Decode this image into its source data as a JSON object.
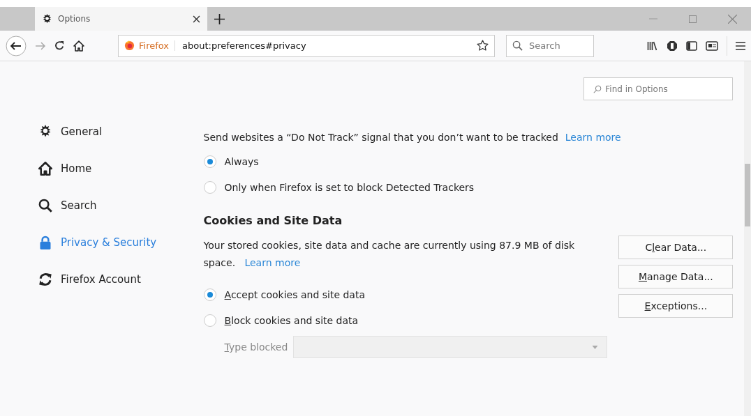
{
  "tab": {
    "title": "Options",
    "selected": true
  },
  "urlbar": {
    "identity": "Firefox",
    "url": "about:preferences#privacy"
  },
  "search": {
    "placeholder": "Search"
  },
  "find": {
    "placeholder": "Find in Options"
  },
  "sidebar": {
    "items": [
      {
        "label": "General",
        "kind": "gear",
        "selected": false
      },
      {
        "label": "Home",
        "kind": "home",
        "selected": false
      },
      {
        "label": "Search",
        "kind": "search",
        "selected": false
      },
      {
        "label": "Privacy & Security",
        "kind": "lock",
        "selected": true
      },
      {
        "label": "Firefox Account",
        "kind": "sync",
        "selected": false
      }
    ]
  },
  "dnt": {
    "text": "Send websites a “Do Not Track” signal that you don’t want to be tracked",
    "link": "Learn more",
    "options": [
      {
        "label": {
          "after": "Always"
        },
        "selected": true
      },
      {
        "label": {
          "after": "Only when Firefox is set to block Detected Trackers"
        },
        "selected": false
      }
    ]
  },
  "cookies": {
    "heading": "Cookies and Site Data",
    "text": "Your stored cookies, site data and cache are currently using 87.9 MB of disk space.",
    "link": "Learn more",
    "buttons": [
      {
        "label": {
          "before": "C",
          "key": "l",
          "after": "ear Data..."
        }
      },
      {
        "label": {
          "key": "M",
          "after": "anage Data..."
        }
      },
      {
        "label": {
          "key": "E",
          "after": "xceptions..."
        }
      }
    ],
    "options": [
      {
        "label": {
          "key": "A",
          "after": "ccept cookies and site data"
        },
        "selected": true
      },
      {
        "label": {
          "key": "B",
          "after": "lock cookies and site data"
        },
        "selected": false
      }
    ],
    "type_blocked": {
      "label": {
        "key": "T",
        "after": "ype blocked"
      },
      "disabled": true
    }
  }
}
